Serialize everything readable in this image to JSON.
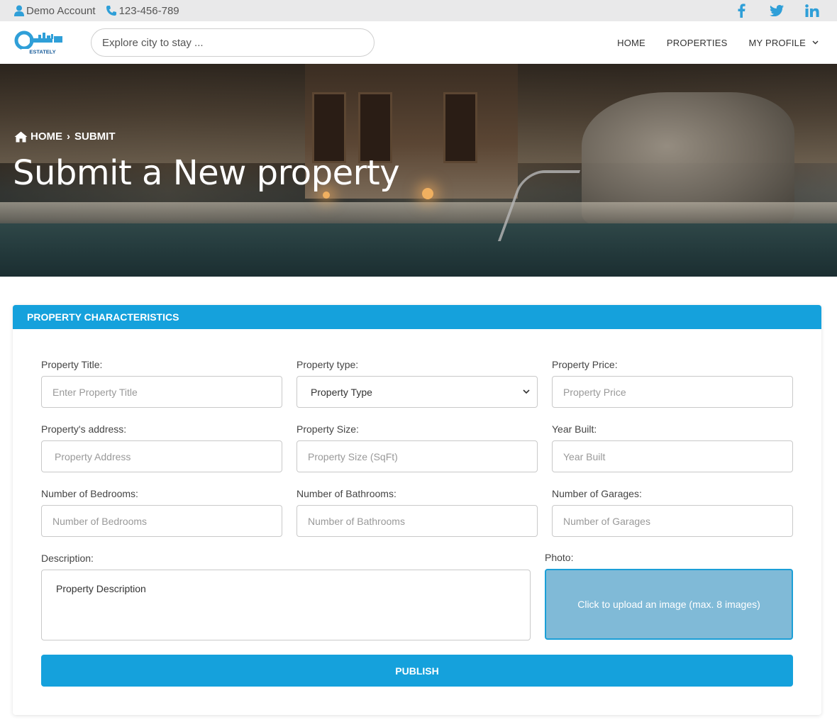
{
  "topbar": {
    "account_label": "Demo Account",
    "phone": "123-456-789",
    "social": [
      "facebook-icon",
      "twitter-icon",
      "linkedin-icon"
    ]
  },
  "header": {
    "logo_text": "ESTATELY",
    "search_placeholder": "Explore city to stay ...",
    "nav": {
      "home": "HOME",
      "properties": "PROPERTIES",
      "profile": "MY PROFILE"
    }
  },
  "hero": {
    "breadcrumb": {
      "home": "HOME",
      "current": "SUBMIT"
    },
    "title": "Submit a New property"
  },
  "form": {
    "section_title": "PROPERTY CHARACTERISTICS",
    "title": {
      "label": "Property Title:",
      "placeholder": "Enter Property Title"
    },
    "type": {
      "label": "Property type:",
      "selected": "Property Type"
    },
    "price": {
      "label": "Property Price:",
      "placeholder": "Property Price"
    },
    "address": {
      "label": "Property's address:",
      "placeholder": "Property Address"
    },
    "size": {
      "label": "Property Size:",
      "placeholder": "Property Size (SqFt)"
    },
    "year": {
      "label": "Year Built:",
      "placeholder": "Year Built"
    },
    "bedrooms": {
      "label": "Number of Bedrooms:",
      "placeholder": "Number of Bedrooms"
    },
    "bathrooms": {
      "label": "Number of Bathrooms:",
      "placeholder": "Number of Bathrooms"
    },
    "garages": {
      "label": "Number of Garages:",
      "placeholder": "Number of Garages"
    },
    "description": {
      "label": "Description:",
      "placeholder": "Property Description"
    },
    "photo": {
      "label": "Photo:",
      "upload_text": "Click to upload an image (max. 8 images)"
    },
    "publish_label": "PUBLISH"
  },
  "colors": {
    "accent": "#15a1dc",
    "upload_bg": "#80bad7",
    "topbar_bg": "#e9e9ea"
  }
}
